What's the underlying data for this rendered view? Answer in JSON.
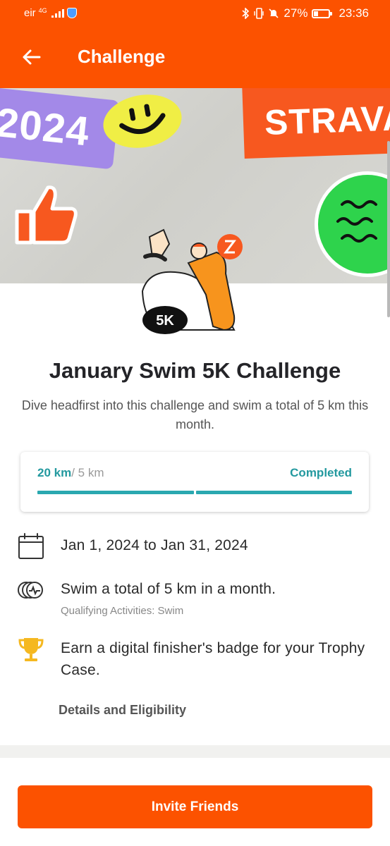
{
  "status_bar": {
    "carrier": "eir",
    "network": "4G",
    "battery": "27%",
    "time": "23:36"
  },
  "app_bar": {
    "title": "Challenge"
  },
  "banner": {
    "sticker_year": "2024",
    "sticker_brand": "STRAVA",
    "badge_label": "5K"
  },
  "challenge": {
    "title": "January Swim 5K Challenge",
    "description": "Dive headfirst into this challenge and swim a total of 5 km this month."
  },
  "progress": {
    "current": "20 km",
    "goal": "/ 5 km",
    "status": "Completed",
    "fraction": 1.0,
    "color": "#2aa8b0"
  },
  "details": {
    "date_range": "Jan 1, 2024 to Jan 31, 2024",
    "goal_text": "Swim a total of 5 km in a month.",
    "qualifying": "Qualifying Activities: Swim",
    "reward": "Earn a digital finisher's badge for your Trophy Case.",
    "link": "Details and Eligibility"
  },
  "actions": {
    "invite": "Invite Friends"
  },
  "colors": {
    "brand": "#fc5200",
    "accent": "#23999f"
  },
  "icons": [
    "back-arrow-icon",
    "calendar-icon",
    "activity-icon",
    "trophy-icon"
  ]
}
